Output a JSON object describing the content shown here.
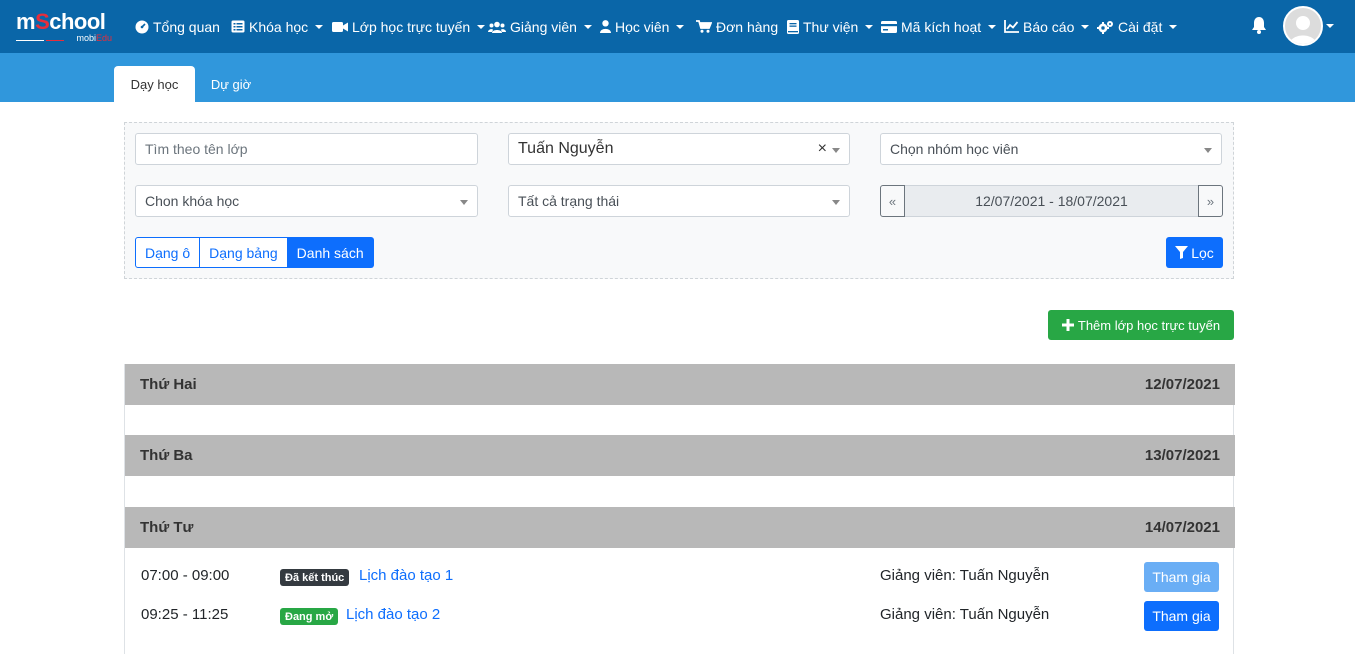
{
  "logo": {
    "brand_pre": "m",
    "brand_o": "S",
    "brand_post": "chool",
    "sub_pre": "mobi",
    "sub_post": "Edu"
  },
  "nav": {
    "overview": "Tổng quan",
    "courses": "Khóa học",
    "online_classes": "Lớp học trực tuyến",
    "teachers": "Giảng viên",
    "students": "Học viên",
    "orders": "Đơn hàng",
    "library": "Thư viện",
    "activation": "Mã kích hoạt",
    "reports": "Báo cáo",
    "settings": "Cài đặt"
  },
  "tabs": {
    "teaching": "Dạy học",
    "observe": "Dự giờ"
  },
  "filters": {
    "class_search_placeholder": "Tìm theo tên lớp",
    "teacher_selected": "Tuấn Nguyễn",
    "student_group": "Chọn nhóm học viên",
    "course": "Chon khóa học",
    "status": "Tất cả trạng thái",
    "date_prev": "«",
    "date_range": "12/07/2021 - 18/07/2021",
    "date_next": "»",
    "clear": "×"
  },
  "views": {
    "grid": "Dạng ô",
    "table": "Dạng bảng",
    "list": "Danh sách"
  },
  "buttons": {
    "filter": "Lọc",
    "add_class": "Thêm lớp học trực tuyến",
    "join": "Tham gia"
  },
  "days": [
    {
      "name": "Thứ Hai",
      "date": "12/07/2021"
    },
    {
      "name": "Thứ Ba",
      "date": "13/07/2021"
    },
    {
      "name": "Thứ Tư",
      "date": "14/07/2021"
    }
  ],
  "sessions": [
    {
      "time": "07:00 - 09:00",
      "status": "Đã kết thúc",
      "title": "Lịch đào tạo 1",
      "teacher": "Giảng viên: Tuấn Nguyễn"
    },
    {
      "time": "09:25 - 11:25",
      "status": "Đang mở",
      "title": "Lịch đào tạo 2",
      "teacher": "Giảng viên: Tuấn Nguyễn"
    }
  ]
}
